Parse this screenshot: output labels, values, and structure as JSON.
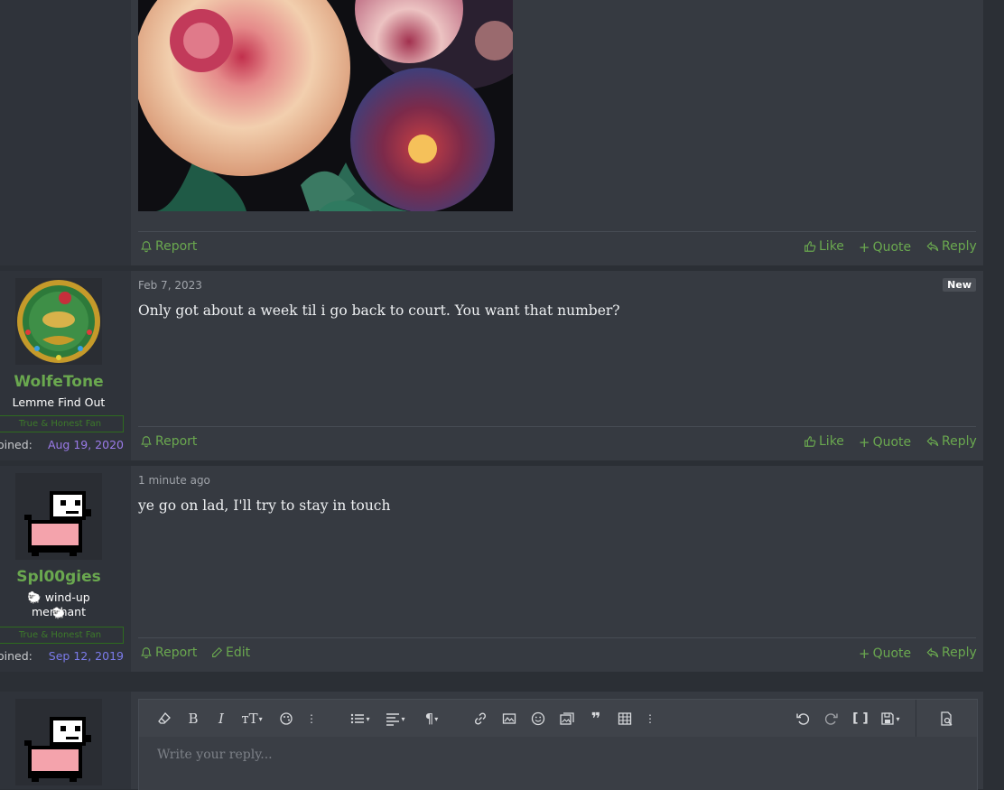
{
  "posts": [
    {
      "actions": {
        "report": "Report",
        "like": "Like",
        "quote": "Quote",
        "reply": "Reply"
      }
    },
    {
      "date": "Feb 7, 2023",
      "badge": "New",
      "text": "Only got about a week til i go back to court. You want that number?",
      "user": {
        "name": "WolfeTone",
        "title": "Lemme Find Out",
        "banner": "True & Honest Fan",
        "joined_label": "oined:",
        "joined_date": "Aug 19, 2020",
        "joined_color": "#9b7bea"
      },
      "actions": {
        "report": "Report",
        "like": "Like",
        "quote": "Quote",
        "reply": "Reply"
      }
    },
    {
      "date": "1 minute ago",
      "text": "ye go on lad, I'll try to stay in touch",
      "user": {
        "name": "Spl00gies",
        "title": "wind-up merchant",
        "banner": "True & Honest Fan",
        "joined_label": "oined:",
        "joined_date": "Sep 12, 2019",
        "joined_color": "#7b7bea"
      },
      "actions": {
        "report": "Report",
        "edit": "Edit",
        "quote": "Quote",
        "reply": "Reply"
      }
    }
  ],
  "editor": {
    "placeholder": "Write your reply...",
    "tools": [
      "eraser-icon",
      "bold-icon",
      "italic-icon",
      "text-size-icon",
      "palette-icon",
      "more-icon",
      "list-icon",
      "align-icon",
      "paragraph-icon",
      "link-icon",
      "image-icon",
      "smiley-icon",
      "media-icon",
      "quote-icon",
      "table-icon",
      "more-icon",
      "undo-icon",
      "redo-icon",
      "bbcode-icon",
      "drafts-icon",
      "preview-icon"
    ]
  },
  "colors": {
    "accent": "#6aa84f",
    "bg": "#2b2f35",
    "post_bg": "#363a41"
  }
}
